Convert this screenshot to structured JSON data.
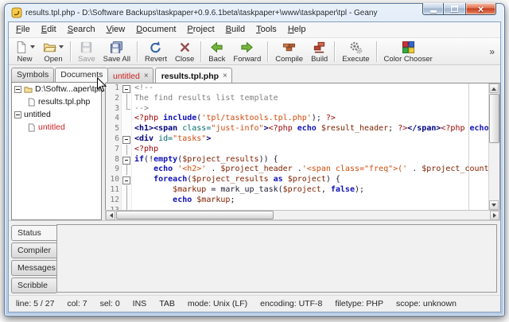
{
  "window": {
    "title": "results.tpl.php - D:\\Software Backups\\taskpaper+0.9.6.1beta\\taskpaper+\\www\\taskpaper\\tpl - Geany",
    "controls": [
      "minimize",
      "maximize",
      "close"
    ]
  },
  "menubar": {
    "items": [
      "File",
      "Edit",
      "Search",
      "View",
      "Document",
      "Project",
      "Build",
      "Tools",
      "Help"
    ]
  },
  "toolbar": {
    "items": [
      {
        "label": "New",
        "icon": "new-document-icon",
        "dropdown": true
      },
      {
        "label": "Open",
        "icon": "open-folder-icon",
        "dropdown": true,
        "sep_after": true
      },
      {
        "label": "Save",
        "icon": "save-icon",
        "disabled": true
      },
      {
        "label": "Save All",
        "icon": "save-all-icon",
        "sep_after": true
      },
      {
        "label": "Revert",
        "icon": "revert-icon"
      },
      {
        "label": "Close",
        "icon": "close-file-icon",
        "sep_after": true
      },
      {
        "label": "Back",
        "icon": "back-arrow-icon"
      },
      {
        "label": "Forward",
        "icon": "forward-arrow-icon",
        "sep_after": true
      },
      {
        "label": "Compile",
        "icon": "compile-icon"
      },
      {
        "label": "Build",
        "icon": "build-icon",
        "sep_after": true
      },
      {
        "label": "Execute",
        "icon": "execute-icon",
        "sep_after": true
      },
      {
        "label": "Color Chooser",
        "icon": "color-chooser-icon"
      }
    ],
    "overflow": "»"
  },
  "sidebar": {
    "tabs": [
      {
        "label": "Symbols",
        "active": false
      },
      {
        "label": "Documents",
        "active": true
      }
    ],
    "tree": [
      {
        "label": "D:\\Softw...aper\\tpl",
        "icon": "folder-icon",
        "children": [
          {
            "label": "results.tpl.php",
            "icon": "file-icon",
            "color": "#161616"
          }
        ]
      },
      {
        "label": "untitled",
        "icon": null,
        "children": [
          {
            "label": "untitled",
            "icon": "file-icon",
            "color": "#cc2222"
          }
        ]
      }
    ]
  },
  "editor": {
    "tabs": [
      {
        "label": "untitled",
        "color": "#cc2222",
        "active": false,
        "close": "×"
      },
      {
        "label": "results.tpl.php",
        "color": "#101010",
        "active": true,
        "close": "×"
      }
    ],
    "lines": [
      {
        "n": 1,
        "fold": "box",
        "segs": [
          {
            "t": "<!--",
            "c": "com"
          }
        ]
      },
      {
        "n": 2,
        "fold": "line",
        "segs": [
          {
            "t": "The find results list template",
            "c": "com"
          }
        ]
      },
      {
        "n": 3,
        "fold": "end",
        "segs": [
          {
            "t": "-->",
            "c": "com"
          }
        ]
      },
      {
        "n": 4,
        "fold": "",
        "segs": [
          {
            "t": "<?php ",
            "c": "phpd"
          },
          {
            "t": "include",
            "c": "kw"
          },
          {
            "t": "(",
            "c": "def"
          },
          {
            "t": "'tpl/tasktools.tpl.php'",
            "c": "str"
          },
          {
            "t": "); ",
            "c": "def"
          },
          {
            "t": "?>",
            "c": "phpd"
          }
        ]
      },
      {
        "n": 5,
        "fold": "",
        "segs": [
          {
            "t": "<h1><span ",
            "c": "tag"
          },
          {
            "t": "class=",
            "c": "attr"
          },
          {
            "t": "\"just-info\"",
            "c": "val"
          },
          {
            "t": ">",
            "c": "tag"
          },
          {
            "t": "<?php ",
            "c": "phpd"
          },
          {
            "t": "echo ",
            "c": "kw"
          },
          {
            "t": "$result_header",
            "c": "var"
          },
          {
            "t": "; ",
            "c": "def"
          },
          {
            "t": "?>",
            "c": "phpd"
          },
          {
            "t": "</span>",
            "c": "tag"
          },
          {
            "t": "<?php ",
            "c": "phpd"
          },
          {
            "t": "echo",
            "c": "kw"
          }
        ]
      },
      {
        "n": 6,
        "fold": "box",
        "segs": [
          {
            "t": "<div ",
            "c": "tag"
          },
          {
            "t": "id=",
            "c": "attr"
          },
          {
            "t": "\"tasks\"",
            "c": "val"
          },
          {
            "t": ">",
            "c": "tag"
          }
        ]
      },
      {
        "n": 7,
        "fold": "line",
        "segs": [
          {
            "t": "<?php",
            "c": "phpd"
          }
        ]
      },
      {
        "n": 8,
        "fold": "box",
        "segs": [
          {
            "t": "if",
            "c": "kw"
          },
          {
            "t": "(!",
            "c": "def"
          },
          {
            "t": "empty",
            "c": "kw"
          },
          {
            "t": "(",
            "c": "def"
          },
          {
            "t": "$project_results",
            "c": "var"
          },
          {
            "t": ")) {",
            "c": "def"
          }
        ]
      },
      {
        "n": 9,
        "fold": "line",
        "segs": [
          {
            "t": "    ",
            "c": "def"
          },
          {
            "t": "echo ",
            "c": "kw"
          },
          {
            "t": "'<h2>'",
            "c": "str"
          },
          {
            "t": " . ",
            "c": "def"
          },
          {
            "t": "$project_header",
            "c": "var"
          },
          {
            "t": " .",
            "c": "def"
          },
          {
            "t": "'<span class=\"freq\">('",
            "c": "str"
          },
          {
            "t": " . ",
            "c": "def"
          },
          {
            "t": "$project_count",
            "c": "var"
          }
        ]
      },
      {
        "n": 10,
        "fold": "box",
        "segs": [
          {
            "t": "    ",
            "c": "def"
          },
          {
            "t": "foreach",
            "c": "kw"
          },
          {
            "t": "(",
            "c": "def"
          },
          {
            "t": "$project_results",
            "c": "var"
          },
          {
            "t": " as ",
            "c": "kw"
          },
          {
            "t": "$project",
            "c": "var"
          },
          {
            "t": ") {",
            "c": "def"
          }
        ]
      },
      {
        "n": 11,
        "fold": "line",
        "segs": [
          {
            "t": "        ",
            "c": "def"
          },
          {
            "t": "$markup",
            "c": "var"
          },
          {
            "t": " = mark_up_task(",
            "c": "def"
          },
          {
            "t": "$project",
            "c": "var"
          },
          {
            "t": ", ",
            "c": "def"
          },
          {
            "t": "false",
            "c": "kw"
          },
          {
            "t": ");",
            "c": "def"
          }
        ]
      },
      {
        "n": 12,
        "fold": "line",
        "segs": [
          {
            "t": "        ",
            "c": "def"
          },
          {
            "t": "echo ",
            "c": "kw"
          },
          {
            "t": "$markup",
            "c": "var"
          },
          {
            "t": ";",
            "c": "def"
          }
        ]
      },
      {
        "n": 13,
        "fold": "line",
        "segs": []
      }
    ]
  },
  "bottom_panel": {
    "tabs": [
      {
        "label": "Status",
        "active": true
      },
      {
        "label": "Compiler",
        "active": false
      },
      {
        "label": "Messages",
        "active": false
      },
      {
        "label": "Scribble",
        "active": false
      }
    ]
  },
  "statusbar": {
    "fields": [
      "line: 5 / 27",
      "col: 7",
      "sel: 0",
      "INS",
      "TAB",
      "mode: Unix (LF)",
      "encoding: UTF-8",
      "filetype: PHP",
      "scope: unknown"
    ]
  }
}
